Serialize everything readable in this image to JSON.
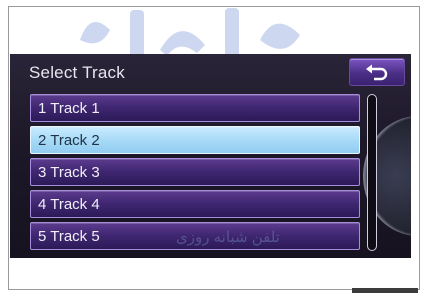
{
  "header": {
    "title": "Select Track",
    "back_icon": "return-arrow-icon"
  },
  "tracks": [
    {
      "label": "1 Track 1",
      "selected": false
    },
    {
      "label": "2 Track 2",
      "selected": true
    },
    {
      "label": "3 Track 3",
      "selected": false
    },
    {
      "label": "4 Track 4",
      "selected": false
    },
    {
      "label": "5 Track 5",
      "selected": false
    }
  ],
  "watermark": {
    "text": "تلفن شبانه روزی"
  },
  "colors": {
    "row_fill": "#3f2670",
    "row_border": "#a58fdc",
    "selected_fill": "#a8daf7",
    "button_fill": "#5b3a9e",
    "screen_bg": "#1d1828"
  }
}
